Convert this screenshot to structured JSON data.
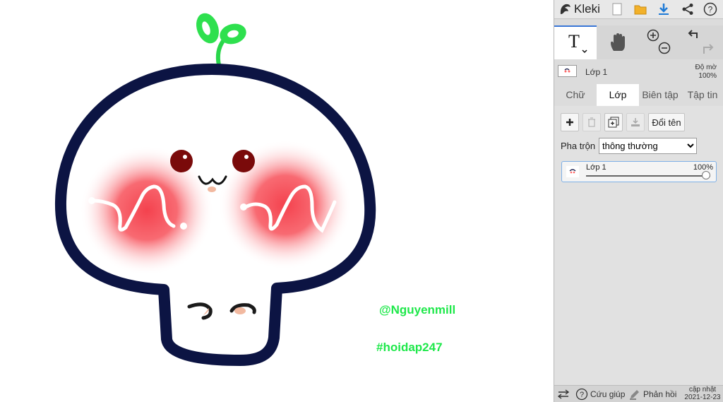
{
  "canvas": {
    "signature_user": "@Nguyenmill",
    "signature_tag": "#hoidap247"
  },
  "app": {
    "name": "Kleki"
  },
  "layer_strip": {
    "layer_name": "Lớp 1",
    "opacity_label": "Độ mờ",
    "opacity_value": "100%"
  },
  "tabs": [
    {
      "label": "Chữ"
    },
    {
      "label": "Lớp"
    },
    {
      "label": "Biên tập"
    },
    {
      "label": "Tập tin"
    }
  ],
  "layers": {
    "rename_label": "Đổi tên",
    "blend_label": "Pha trộn",
    "blend_value": "thông thường",
    "item": {
      "name": "Lớp 1",
      "opacity": "100%",
      "opacity_fraction": 1.0
    }
  },
  "status": {
    "help_label": "Cứu giúp",
    "feedback_label": "Phản hồi",
    "update_label": "cập nhật",
    "update_date": "2021-12-23"
  },
  "colors": {
    "accent": "#3a76d6",
    "signature": "#1ee84a",
    "outline": "#0c1443"
  }
}
